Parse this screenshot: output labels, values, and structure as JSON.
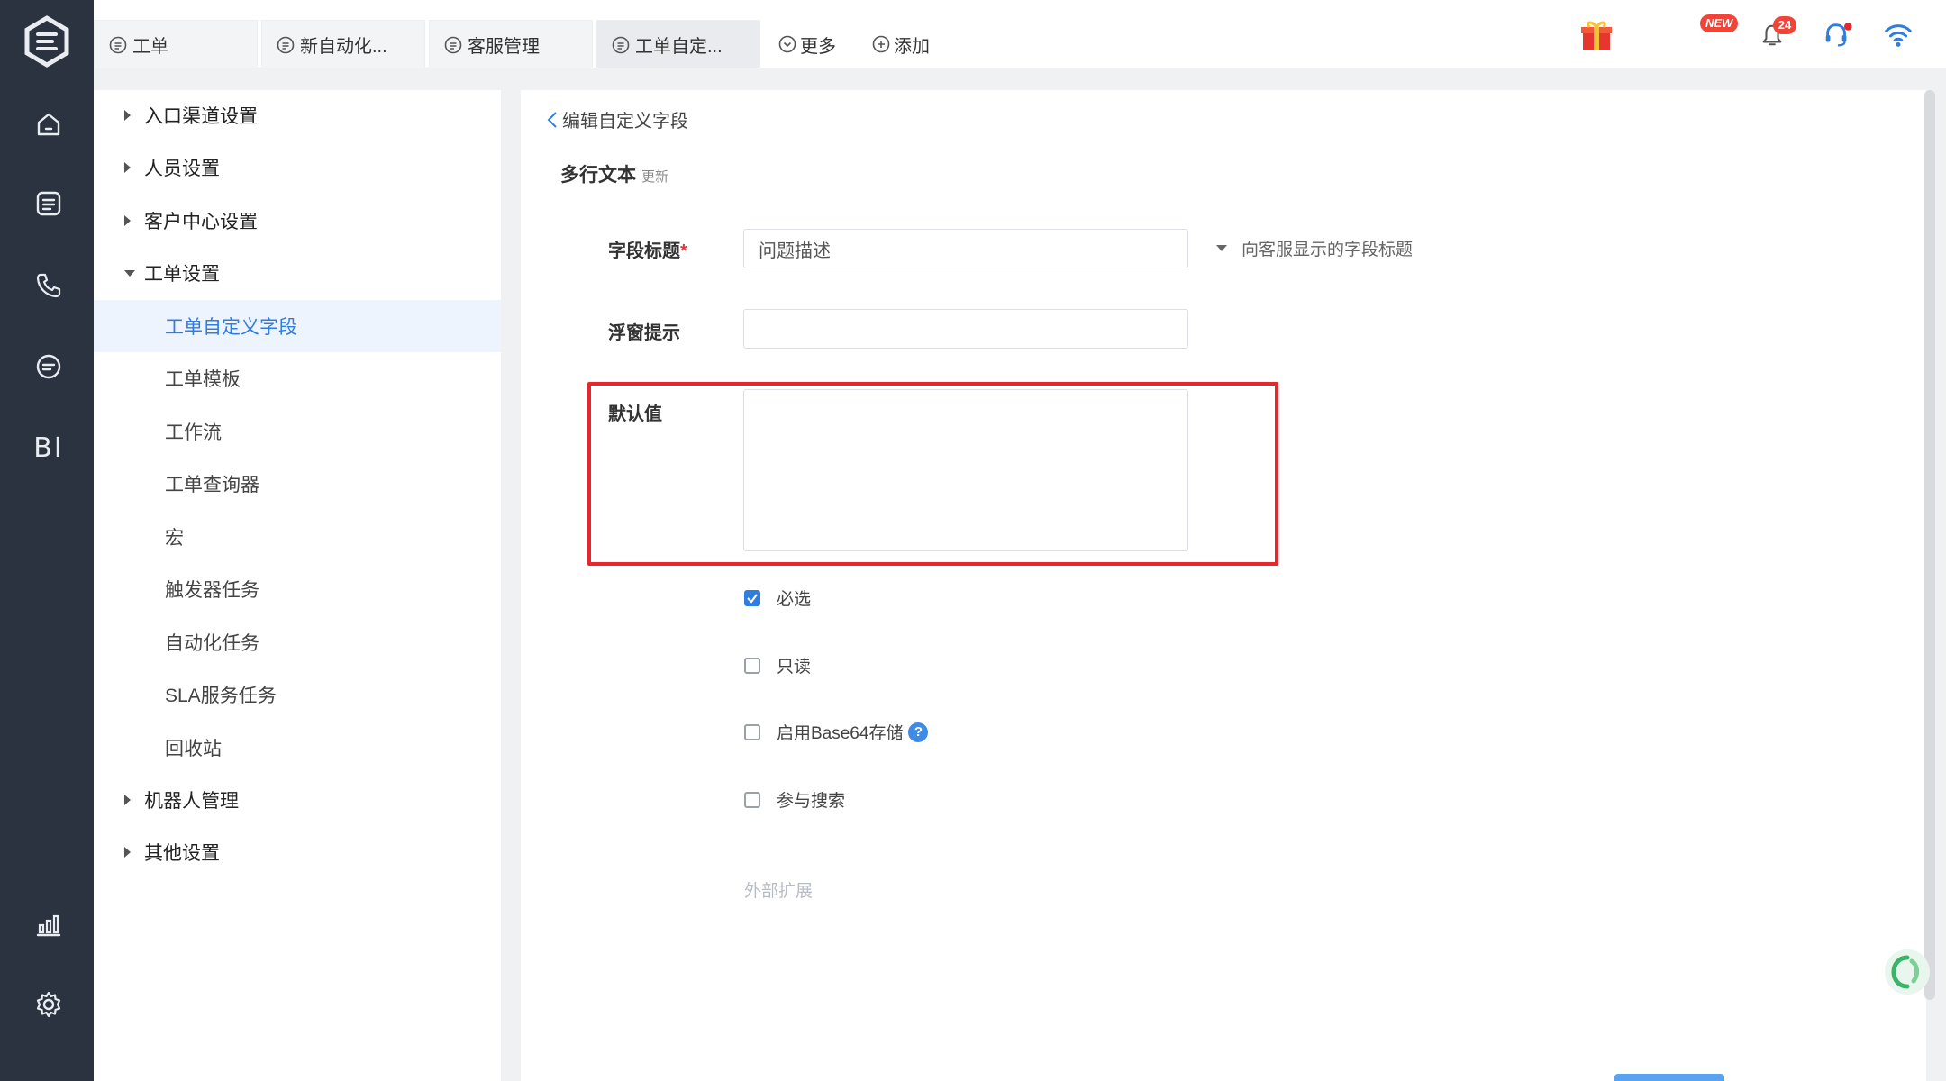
{
  "rail": {
    "items": [
      {
        "name": "home-icon"
      },
      {
        "name": "ticket-list-icon"
      },
      {
        "name": "phone-icon"
      },
      {
        "name": "chat-icon"
      },
      {
        "name": "bi-label",
        "text": "BI"
      },
      {
        "name": "chart-icon"
      },
      {
        "name": "settings-icon"
      }
    ]
  },
  "tabs": [
    {
      "label": "工单"
    },
    {
      "label": "新自动化..."
    },
    {
      "label": "客服管理"
    },
    {
      "label": "工单自定..."
    }
  ],
  "tab_more": "更多",
  "tab_add": "添加",
  "topbar": {
    "gift_badge": "NEW",
    "notification_count": "24"
  },
  "sidebar": {
    "groups": [
      {
        "label": "入口渠道设置"
      },
      {
        "label": "人员设置"
      },
      {
        "label": "客户中心设置"
      },
      {
        "label": "工单设置"
      },
      {
        "label": "机器人管理"
      },
      {
        "label": "其他设置"
      }
    ],
    "sub_items": [
      {
        "label": "工单自定义字段"
      },
      {
        "label": "工单模板"
      },
      {
        "label": "工作流"
      },
      {
        "label": "工单查询器"
      },
      {
        "label": "宏"
      },
      {
        "label": "触发器任务"
      },
      {
        "label": "自动化任务"
      },
      {
        "label": "SLA服务任务"
      },
      {
        "label": "回收站"
      }
    ]
  },
  "main": {
    "back_label": "编辑自定义字段",
    "section_title": "多行文本",
    "section_sub": "更新",
    "field_title_label": "字段标题",
    "field_title_required": "*",
    "field_title_value": "问题描述",
    "field_title_hint": "向客服显示的字段标题",
    "tooltip_label": "浮窗提示",
    "tooltip_value": "",
    "default_label": "默认值",
    "default_value": "",
    "checkboxes": [
      {
        "label": "必选",
        "checked": true
      },
      {
        "label": "只读",
        "checked": false
      },
      {
        "label": "启用Base64存储",
        "checked": false,
        "help": "?"
      },
      {
        "label": "参与搜索",
        "checked": false
      }
    ],
    "external_ext": "外部扩展"
  }
}
